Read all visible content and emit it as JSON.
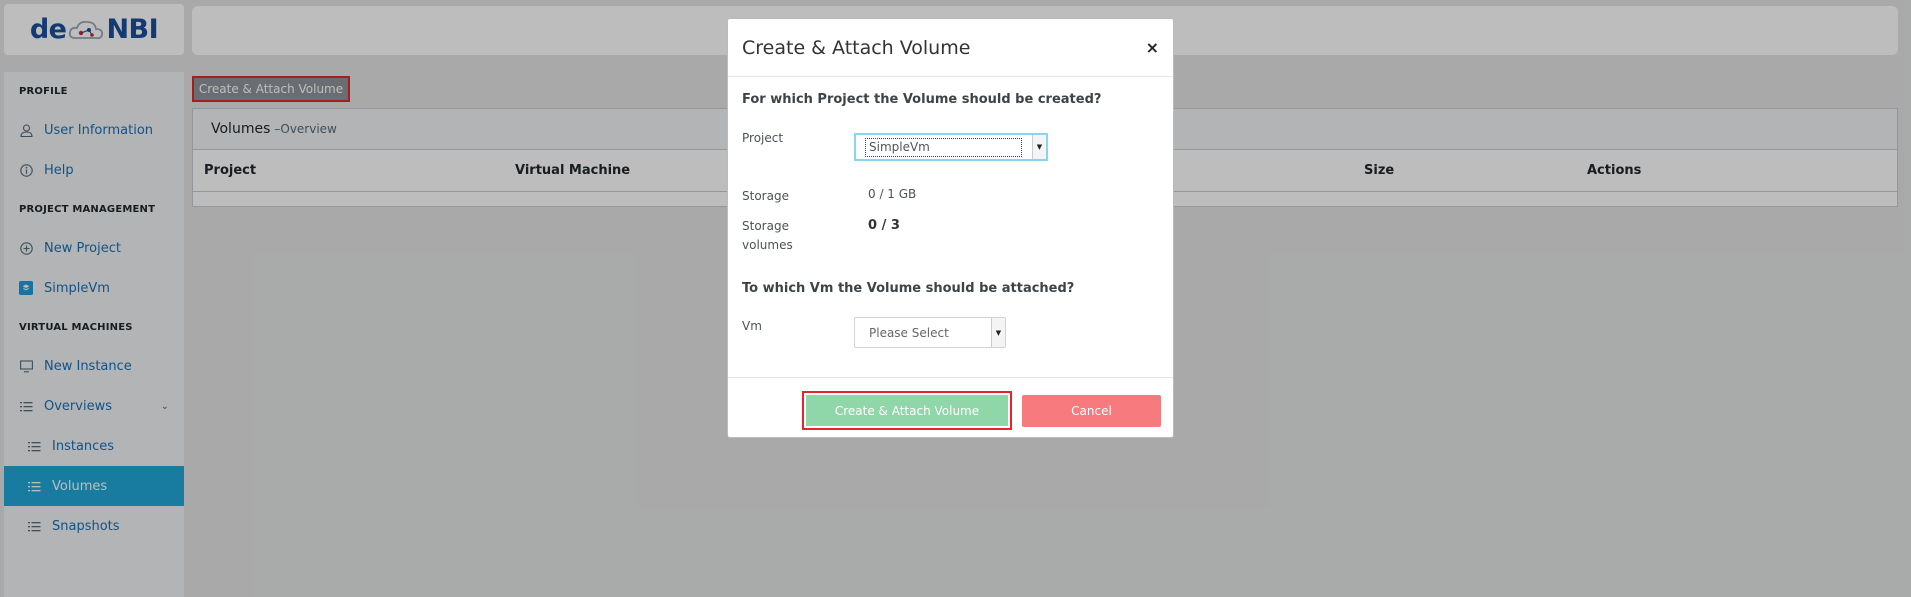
{
  "logo": {
    "text_left": "de",
    "text_right": "NBI"
  },
  "sidebar": {
    "sections": [
      {
        "title": "PROFILE",
        "items": [
          {
            "label": "User Information",
            "icon": "user-icon"
          },
          {
            "label": "Help",
            "icon": "info-icon"
          }
        ]
      },
      {
        "title": "PROJECT MANAGEMENT",
        "items": [
          {
            "label": "New Project",
            "icon": "plus-circle-icon"
          },
          {
            "label": "SimpleVm",
            "icon": "simplevm-logo-icon"
          }
        ]
      },
      {
        "title": "VIRTUAL MACHINES",
        "items": [
          {
            "label": "New Instance",
            "icon": "monitor-icon"
          },
          {
            "label": "Overviews",
            "icon": "list-icon"
          },
          {
            "label": "Instances",
            "icon": "list-icon"
          },
          {
            "label": "Volumes",
            "icon": "list-icon"
          },
          {
            "label": "Snapshots",
            "icon": "list-icon"
          }
        ]
      }
    ],
    "active": "Volumes"
  },
  "main": {
    "create_button": "Create & Attach Volume",
    "card_title": "Volumes",
    "card_subtitle": "–Overview",
    "columns": [
      "Project",
      "Virtual Machine",
      "Size",
      "Actions"
    ]
  },
  "modal": {
    "title": "Create & Attach Volume",
    "close": "×",
    "question_project": "For which Project the Volume should be created?",
    "project_label": "Project",
    "project_value": "SimpleVm",
    "storage_label": "Storage",
    "storage_value": "0 / 1 GB",
    "storage_volumes_label_1": "Storage",
    "storage_volumes_label_2": "volumes",
    "storage_volumes_value": "0 / 3",
    "question_vm": "To which Vm the Volume should be attached?",
    "vm_label": "Vm",
    "vm_placeholder": "Please Select",
    "create_button": "Create & Attach Volume",
    "cancel_button": "Cancel",
    "colors": {
      "create": "#8fd6a8",
      "cancel": "#f77a7e",
      "highlight": "#e2262b"
    }
  }
}
